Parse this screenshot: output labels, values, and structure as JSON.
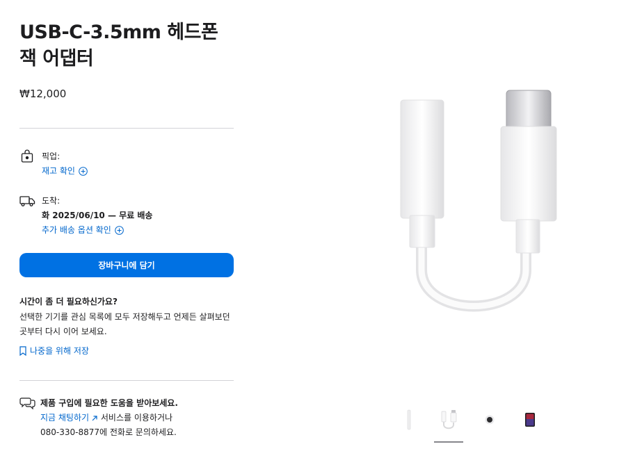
{
  "product": {
    "title": "USB-C-3.5mm 헤드폰 잭 어댑터",
    "price": "₩12,000"
  },
  "pickup": {
    "label": "픽업:",
    "link": "재고 확인"
  },
  "delivery": {
    "label": "도착:",
    "date": "화 2025/06/10 — 무료 배송",
    "link": "추가 배송 옵션 확인"
  },
  "cart_button": "장바구니에 담기",
  "save": {
    "heading": "시간이 좀 더 필요하신가요?",
    "body": "선택한 기기를 관심 목록에 모두 저장해두고 언제든 살펴보던 곳부터 다시 이어 보세요.",
    "link": "나중을 위해 저장"
  },
  "help": {
    "title": "제품 구입에 필요한 도움을 받아보세요.",
    "chat_link": "지금 채팅하기",
    "after_link": " 서비스를 이용하거나",
    "phone_line": "080-330-8877에 전화로 문의하세요."
  },
  "colors": {
    "accent": "#0071e3",
    "link": "#0066cc"
  }
}
